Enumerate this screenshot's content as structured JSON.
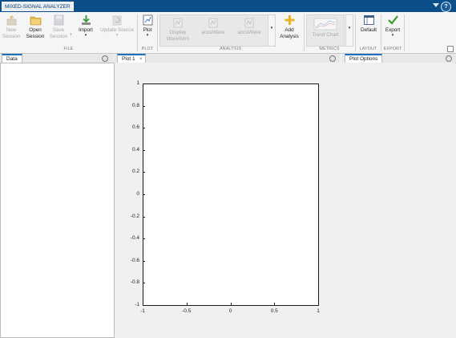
{
  "app": {
    "title": "MIXED-SIGNAL ANALYZER",
    "help_label": "?"
  },
  "toolstrip": {
    "file": {
      "section_label": "FILE",
      "new_session": {
        "line1": "New",
        "line2": "Session"
      },
      "open_session": {
        "line1": "Open",
        "line2": "Session"
      },
      "save_session": {
        "line1": "Save",
        "line2": "Session"
      },
      "import": {
        "line1": "Import"
      },
      "update_source": {
        "line1": "Update Source"
      }
    },
    "plot": {
      "section_label": "PLOT",
      "plot_button": {
        "line1": "Plot"
      }
    },
    "analysis": {
      "section_label": "ANALYSIS",
      "display_waveform": {
        "line1": "Display",
        "line2": "Waveform"
      },
      "item2": {
        "line1": "acosWave"
      },
      "item3": {
        "line1": "acosWave"
      },
      "add_analysis": {
        "line1": "Add",
        "line2": "Analysis"
      }
    },
    "metrics": {
      "section_label": "METRICS",
      "trend_chart": {
        "line1": "Trend Chart"
      }
    },
    "layout": {
      "section_label": "LAYOUT",
      "default": {
        "line1": "Default"
      }
    },
    "export": {
      "section_label": "EXPORT",
      "export": {
        "line1": "Export"
      }
    }
  },
  "panels": {
    "data": {
      "tab_label": "Data"
    },
    "plot": {
      "tab_label": "Plot 1",
      "close_glyph": "×"
    },
    "plot_options": {
      "tab_label": "Plot Options"
    }
  },
  "chart_data": {
    "type": "line",
    "title": "",
    "xlabel": "",
    "ylabel": "",
    "xlim": [
      -1,
      1
    ],
    "ylim": [
      -1,
      1
    ],
    "x_ticks": [
      "-1",
      "-0.5",
      "0",
      "0.5",
      "1"
    ],
    "y_ticks": [
      "1",
      "0.8",
      "0.6",
      "0.4",
      "0.2",
      "0",
      "-0.2",
      "-0.4",
      "-0.6",
      "-0.8",
      "-1"
    ],
    "series": []
  },
  "colors": {
    "titlebar": "#0a4f8a",
    "accent_tab": "#1f6fbf",
    "export_check": "#3a9a2a",
    "add_plus": "#e8b422"
  }
}
